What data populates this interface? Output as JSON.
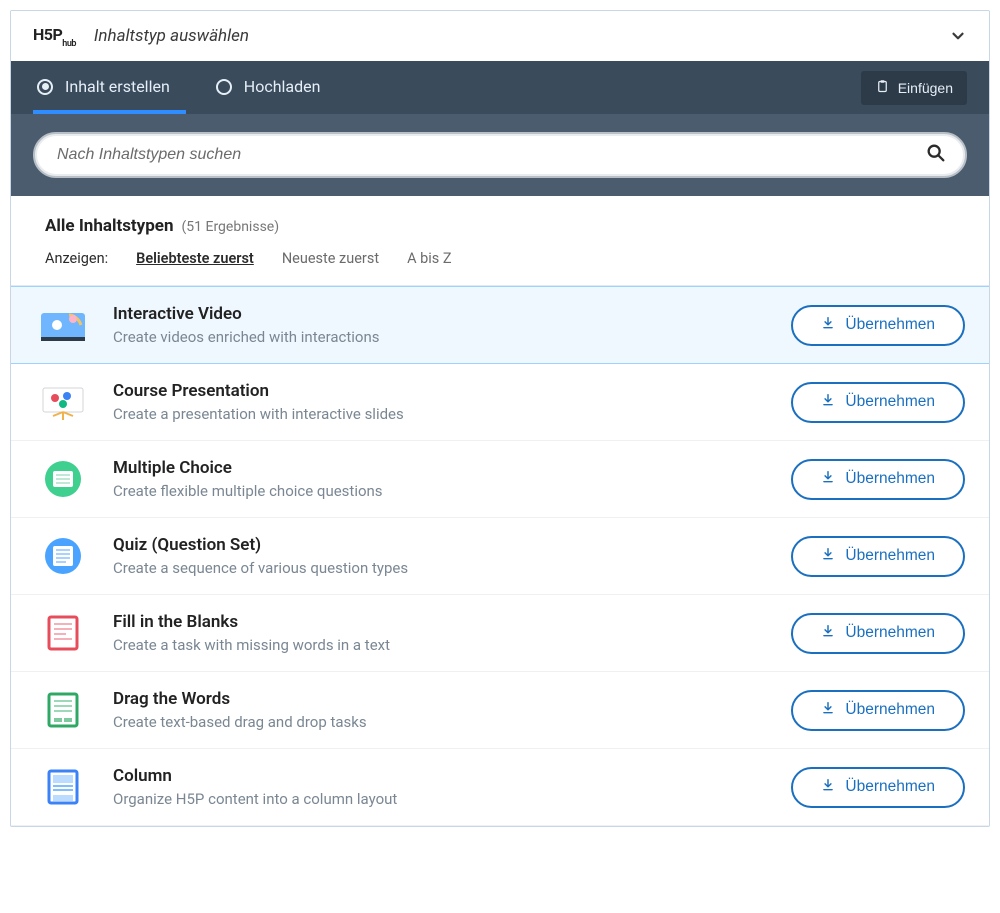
{
  "header": {
    "logo_main": "H5P",
    "logo_sub": "hub",
    "title": "Inhaltstyp auswählen"
  },
  "tabs": {
    "create": "Inhalt erstellen",
    "upload": "Hochladen",
    "paste": "Einfügen"
  },
  "search": {
    "placeholder": "Nach Inhaltstypen suchen"
  },
  "filter": {
    "all_title": "Alle Inhaltstypen",
    "count": "(51 Ergebnisse)",
    "show_label": "Anzeigen:",
    "sort_popular": "Beliebteste zuerst",
    "sort_newest": "Neueste zuerst",
    "sort_alpha": "A bis Z"
  },
  "use_label": "Übernehmen",
  "items": [
    {
      "title": "Interactive Video",
      "desc": "Create videos enriched with interactions"
    },
    {
      "title": "Course Presentation",
      "desc": "Create a presentation with interactive slides"
    },
    {
      "title": "Multiple Choice",
      "desc": "Create flexible multiple choice questions"
    },
    {
      "title": "Quiz (Question Set)",
      "desc": "Create a sequence of various question types"
    },
    {
      "title": "Fill in the Blanks",
      "desc": "Create a task with missing words in a text"
    },
    {
      "title": "Drag the Words",
      "desc": "Create text-based drag and drop tasks"
    },
    {
      "title": "Column",
      "desc": "Organize H5P content into a column layout"
    }
  ]
}
